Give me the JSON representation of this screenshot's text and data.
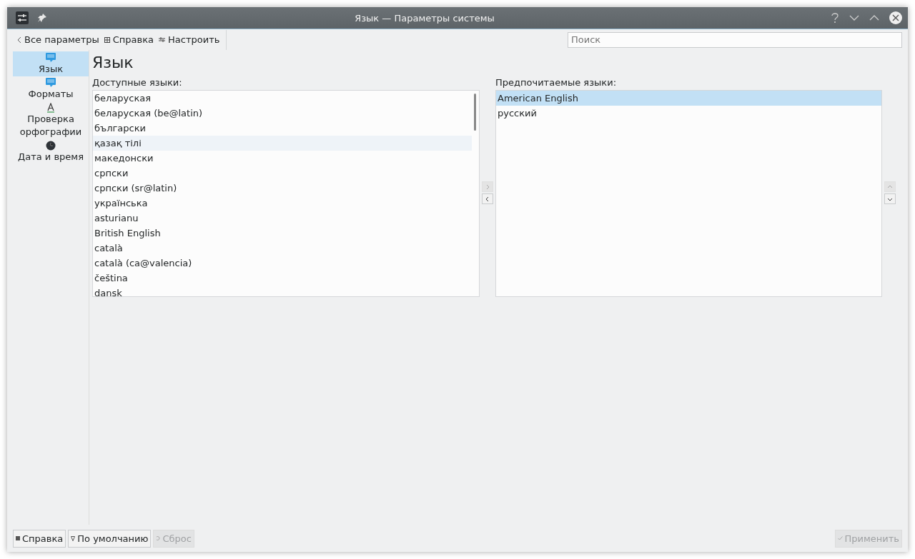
{
  "window": {
    "title": "Язык — Параметры системы"
  },
  "toolbar": {
    "back": "Все параметры",
    "help": "Справка",
    "configure": "Настроить",
    "search": {
      "placeholder": "Поиск"
    }
  },
  "sidebar": {
    "items": [
      {
        "label": "Язык",
        "kind": "language",
        "selected": true
      },
      {
        "label": "Форматы",
        "kind": "formats",
        "selected": false
      },
      {
        "label": "Проверка орфографии",
        "kind": "spelling",
        "selected": false
      },
      {
        "label": "Дата и время",
        "kind": "datetime",
        "selected": false
      }
    ]
  },
  "page": {
    "title": "Язык",
    "available": {
      "label": "Доступные языки:",
      "items": [
        {
          "label": "беларуская",
          "hovered": false
        },
        {
          "label": "беларуская (be@latin)",
          "hovered": false
        },
        {
          "label": "български",
          "hovered": false
        },
        {
          "label": "қазақ тілі",
          "hovered": true
        },
        {
          "label": "македонски",
          "hovered": false
        },
        {
          "label": "српски",
          "hovered": false
        },
        {
          "label": "српски (sr@latin)",
          "hovered": false
        },
        {
          "label": "українська",
          "hovered": false
        },
        {
          "label": "asturianu",
          "hovered": false
        },
        {
          "label": "British English",
          "hovered": false
        },
        {
          "label": "català",
          "hovered": false
        },
        {
          "label": "català (ca@valencia)",
          "hovered": false
        },
        {
          "label": "čeština",
          "hovered": false
        },
        {
          "label": "dansk",
          "hovered": false
        }
      ]
    },
    "move_buttons": [
      {
        "kind": "right",
        "disabled": true
      },
      {
        "kind": "left",
        "disabled": false
      }
    ],
    "preferred": {
      "label": "Предпочитаемые языки:",
      "items": [
        {
          "label": "American English",
          "selected": true
        },
        {
          "label": "русский",
          "selected": false
        }
      ]
    },
    "order_buttons": [
      {
        "kind": "up",
        "disabled": true
      },
      {
        "kind": "down",
        "disabled": false
      }
    ]
  },
  "footer": {
    "buttons": [
      {
        "label": "Справка",
        "kind": "help",
        "disabled": false
      },
      {
        "label": "По умолчанию",
        "kind": "defaults",
        "disabled": false
      },
      {
        "label": "Сброс",
        "kind": "reset",
        "disabled": true
      }
    ],
    "apply": {
      "label": "Применить",
      "kind": "apply",
      "disabled": true
    }
  }
}
